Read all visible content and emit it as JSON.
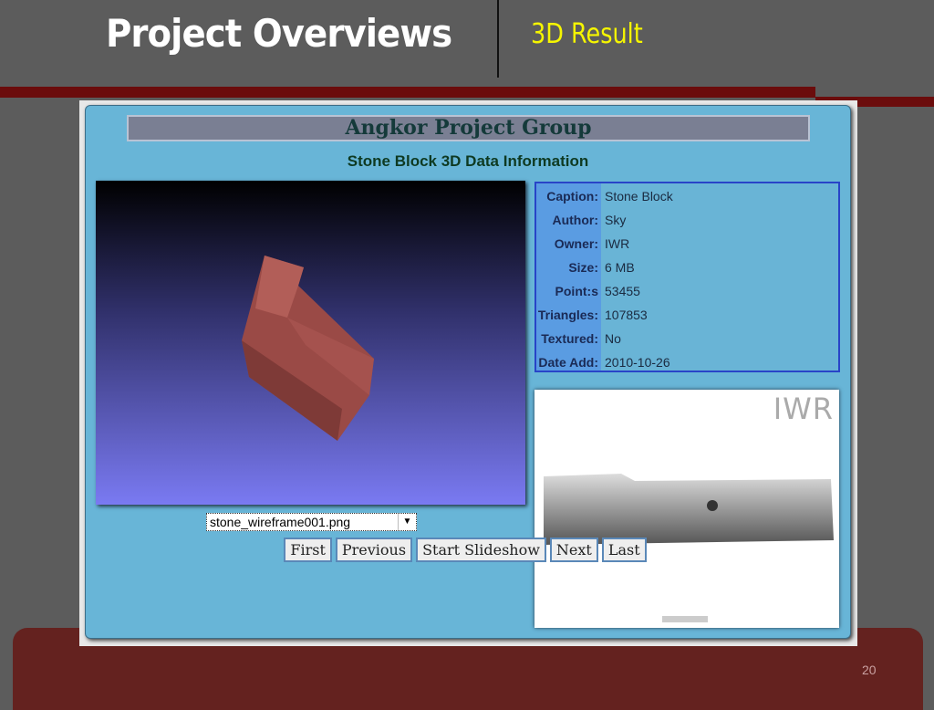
{
  "slide": {
    "title": "Project Overviews",
    "subtitle": "3D Result",
    "page_number": "20"
  },
  "app": {
    "header": "Angkor Project Group",
    "heading": "Stone Block 3D Data Information"
  },
  "info": [
    {
      "label": "Caption:",
      "value": "Stone Block"
    },
    {
      "label": "Author:",
      "value": "Sky"
    },
    {
      "label": "Owner:",
      "value": "IWR"
    },
    {
      "label": "Size:",
      "value": "6 MB"
    },
    {
      "label": "Point:s",
      "value": "53455"
    },
    {
      "label": "Triangles:",
      "value": "107853"
    },
    {
      "label": "Textured:",
      "value": "No"
    },
    {
      "label": "Date Add:",
      "value": "2010-10-26"
    }
  ],
  "preview": {
    "logo": "IWR"
  },
  "selector": {
    "value": "stone_wireframe001.png"
  },
  "buttons": {
    "first": "First",
    "previous": "Previous",
    "slideshow": "Start Slideshow",
    "next": "Next",
    "last": "Last"
  }
}
